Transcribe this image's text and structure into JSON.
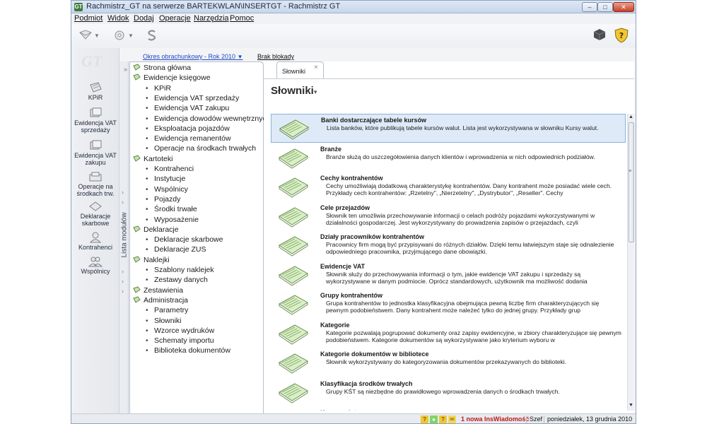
{
  "window": {
    "title": "Rachmistrz_GT na serwerze BARTEKWLAN\\INSERTGT - Rachmistrz GT",
    "app_icon": "GT",
    "minimize": "–",
    "maximize": "□",
    "close": "✕"
  },
  "menu": [
    "Podmiot",
    "Widok",
    "Dodaj",
    "Operacje",
    "Narzędzia",
    "Pomoc"
  ],
  "toolbar": {
    "icons": [
      "envelope-icon",
      "gear-icon",
      "s-icon",
      "cube-icon",
      "shield-help-icon"
    ],
    "shield_glyph": "?"
  },
  "leftnav": {
    "logo": "GT",
    "items": [
      {
        "label": "KPiR",
        "icon": "ledger-icon"
      },
      {
        "label": "Ewidencja VAT sprzedaży",
        "icon": "ledger-icon"
      },
      {
        "label": "Ewidencja VAT zakupu",
        "icon": "ledger-icon"
      },
      {
        "label": "Operacje na środkach trw.",
        "icon": "assets-icon"
      },
      {
        "label": "Deklaracje skarbowe",
        "icon": "declaration-icon"
      },
      {
        "label": "Kontrahenci",
        "icon": "person-icon"
      },
      {
        "label": "Wspólnicy",
        "icon": "people-icon"
      }
    ]
  },
  "sidebar": {
    "tab_label": "Lista modułów",
    "period_link": "Okres obrachunkowy - Rok 2010",
    "lock_status": "Brak blokady",
    "tree": [
      {
        "type": "group",
        "label": "Strona główna"
      },
      {
        "type": "group",
        "label": "Ewidencje księgowe"
      },
      {
        "type": "leaf",
        "label": "KPiR"
      },
      {
        "type": "leaf",
        "label": "Ewidencja VAT sprzedaży"
      },
      {
        "type": "leaf",
        "label": "Ewidencja VAT zakupu"
      },
      {
        "type": "leaf",
        "label": "Ewidencja dowodów wewnętrznych"
      },
      {
        "type": "leaf",
        "label": "Eksploatacja pojazdów"
      },
      {
        "type": "leaf",
        "label": "Ewidencja remanentów"
      },
      {
        "type": "leaf",
        "label": "Operacje na środkach trwałych"
      },
      {
        "type": "group",
        "label": "Kartoteki"
      },
      {
        "type": "leaf",
        "label": "Kontrahenci"
      },
      {
        "type": "leaf",
        "label": "Instytucje"
      },
      {
        "type": "leaf",
        "label": "Wspólnicy"
      },
      {
        "type": "leaf",
        "label": "Pojazdy"
      },
      {
        "type": "leaf",
        "label": "Środki trwałe"
      },
      {
        "type": "leaf",
        "label": "Wyposażenie"
      },
      {
        "type": "group",
        "label": "Deklaracje"
      },
      {
        "type": "leaf",
        "label": "Deklaracje skarbowe"
      },
      {
        "type": "leaf",
        "label": "Deklaracje ZUS"
      },
      {
        "type": "group",
        "label": "Naklejki"
      },
      {
        "type": "leaf",
        "label": "Szablony naklejek"
      },
      {
        "type": "leaf",
        "label": "Zestawy danych"
      },
      {
        "type": "group",
        "label": "Zestawienia"
      },
      {
        "type": "group",
        "label": "Administracja"
      },
      {
        "type": "leaf",
        "label": "Parametry"
      },
      {
        "type": "leaf",
        "label": "Słowniki"
      },
      {
        "type": "leaf",
        "label": "Wzorce wydruków"
      },
      {
        "type": "leaf",
        "label": "Schematy importu"
      },
      {
        "type": "leaf",
        "label": "Biblioteka dokumentów"
      }
    ]
  },
  "main": {
    "tab_label": "Słowniki",
    "tab_close": "×",
    "title": "Słowniki",
    "items": [
      {
        "title": "Banki dostarczające tabele kursów",
        "desc": "Lista banków, które publikują tabele kursów walut. Lista jest wykorzystywana w słowniku Kursy walut.",
        "selected": true
      },
      {
        "title": "Branże",
        "desc": "Branże służą do uszczegółowienia danych klientów i wprowadzenia w nich odpowiednich podziałów."
      },
      {
        "title": "Cechy kontrahentów",
        "desc": "Cechy umożliwiają dodatkową charakterystykę kontrahentów. Dany kontrahent może posiadać wiele cech. Przykłady cech kontrahentów: „Rzetelny\", „Nierzetelny\", „Dystrybutor\", „Reseller\". Cechy"
      },
      {
        "title": "Cele przejazdów",
        "desc": "Słownik ten umożliwia przechowywanie informacji o celach podróży pojazdami wykorzystywanymi w działalności gospodarczej. Jest wykorzystywany do prowadzenia zapisów o przejazdach, czyli"
      },
      {
        "title": "Działy pracowników kontrahentów",
        "desc": "Pracownicy firm mogą być przypisywani do różnych działów. Dzięki temu łatwiejszym staje się odnalezienie odpowiedniego pracownika, przyjmującego dane obowiązki."
      },
      {
        "title": "Ewidencje VAT",
        "desc": "Słownik służy do przechowywania informacji o tym, jakie ewidencje VAT zakupu i sprzedaży są wykorzystywane w danym podmiocie. Oprócz standardowych, użytkownik ma możliwość dodania"
      },
      {
        "title": "Grupy kontrahentów",
        "desc": "Grupa kontrahentów to jednostka klasyfikacyjna obejmująca pewną liczbę firm charakteryzujących się pewnym podobieństwem. Dany kontrahent może należeć tylko do jednej grupy. Przykłady grup"
      },
      {
        "title": "Kategorie",
        "desc": "Kategorie pozwalają pogrupować dokumenty oraz zapisy ewidencyjne, w zbiory charakteryzujące się pewnym podobieństwem. Kategorie dokumentów są wykorzystywane jako kryterium wyboru w"
      },
      {
        "title": "Kategorie dokumentów w bibliotece",
        "desc": "Słownik wykorzystywany do kategoryzowania dokumentów przekazywanych do biblioteki."
      },
      {
        "title": "Klasyfikacja środków trwałych",
        "desc": "Grupy KŚT są niezbędne do prawidłowego wprowadzenia danych o środkach trwałych."
      },
      {
        "title": "Kursy walut",
        "desc": ""
      }
    ]
  },
  "statusbar": {
    "messages": "1 nowa InsWiadomość",
    "user": "Szef",
    "date": "poniedziałek, 13 grudnia 2010"
  },
  "colors": {
    "accent": "#1f49c6",
    "selection": "#dfeaf8",
    "alert": "#c01818"
  }
}
